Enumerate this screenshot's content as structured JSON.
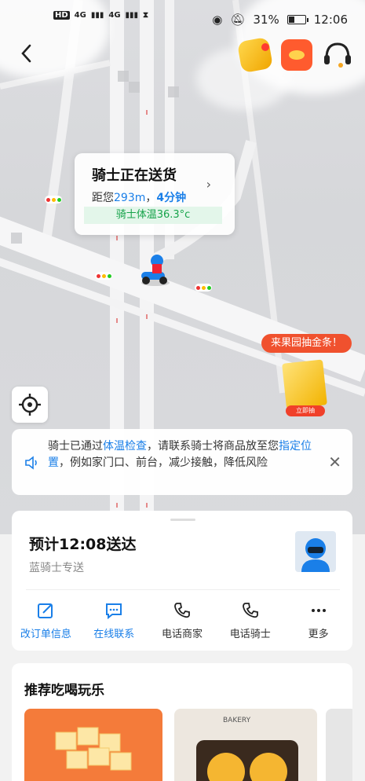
{
  "status_bar": {
    "sim_badges": [
      "HD",
      "HD"
    ],
    "network": [
      "4G",
      "4G"
    ],
    "battery_text": "31%",
    "time": "12:06",
    "battery_level": 0.31
  },
  "header": {
    "back_icon": "chevron-left-icon",
    "icons": [
      "gold-coin-icon",
      "red-packet-icon",
      "customer-service-icon"
    ]
  },
  "rider_card": {
    "title": "骑士正在送货",
    "distance_prefix": "距您",
    "distance": "293m",
    "separator": "，",
    "time": "4分钟",
    "temperature": "骑士体温36.3°c"
  },
  "promo": {
    "bubble": "来果园抽金条！",
    "button": "立即抽"
  },
  "notice": {
    "part1": "骑士已通过",
    "link1": "体温检查",
    "part2": "，请联系骑士将商品放至您",
    "link2": "指定位置",
    "part3": "，例如家门口、前台，减少接触，降低风险"
  },
  "delivery": {
    "eta": "预计12:08送达",
    "rider_type": "蓝骑士专送",
    "actions": [
      {
        "label": "改订单信息",
        "icon": "edit-icon",
        "accent": true
      },
      {
        "label": "在线联系",
        "icon": "chat-icon",
        "accent": true
      },
      {
        "label": "电话商家",
        "icon": "phone-icon",
        "accent": false
      },
      {
        "label": "电话骑士",
        "icon": "phone-icon",
        "accent": false
      },
      {
        "label": "更多",
        "icon": "more-icon",
        "accent": false
      }
    ]
  },
  "recommend": {
    "title": "推荐吃喝玩乐",
    "img2_text": "BAKERY"
  },
  "colors": {
    "accent": "#1a7fe8",
    "promo_red": "#f0512e",
    "temp_green": "#16a34a"
  }
}
